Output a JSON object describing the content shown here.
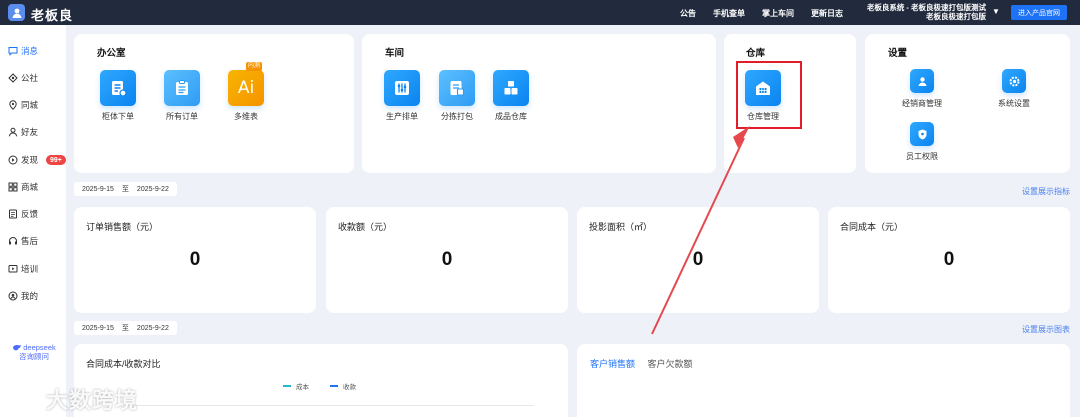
{
  "app": {
    "brand": "老板良"
  },
  "topnav": {
    "announce": "公告",
    "mobile": "手机查单",
    "workshop": "掌上车间",
    "changelog": "更新日志",
    "system_line1": "老板良系统 - 老板良极速打包版测试",
    "system_line2": "老板良极速打包版",
    "enter_site": "进入产品官网"
  },
  "sidebar": {
    "items": [
      {
        "label": "消息",
        "icon": "message-icon",
        "active": true
      },
      {
        "label": "公社",
        "icon": "community-icon"
      },
      {
        "label": "同城",
        "icon": "location-icon"
      },
      {
        "label": "好友",
        "icon": "friends-icon"
      },
      {
        "label": "发现",
        "icon": "discover-icon",
        "badge": "99+"
      },
      {
        "label": "商城",
        "icon": "mall-icon"
      },
      {
        "label": "反馈",
        "icon": "feedback-icon"
      },
      {
        "label": "售后",
        "icon": "after-sales-icon"
      },
      {
        "label": "培训",
        "icon": "training-icon"
      },
      {
        "label": "我的",
        "icon": "profile-icon"
      }
    ],
    "deepseek": {
      "name": "deepseek",
      "caption": "咨询顾问"
    }
  },
  "office": {
    "title": "办公室",
    "apps": [
      {
        "label": "柜体下单",
        "icon": "cabinet-order-icon"
      },
      {
        "label": "所有订单",
        "icon": "all-orders-icon"
      },
      {
        "label": "多维表",
        "icon": "ai-table-icon",
        "glyph": "Ai",
        "tag": "内测"
      }
    ]
  },
  "workshop": {
    "title": "车间",
    "apps": [
      {
        "label": "生产排单",
        "icon": "production-schedule-icon"
      },
      {
        "label": "分拣打包",
        "icon": "sorting-packing-icon"
      },
      {
        "label": "成品仓库",
        "icon": "finished-goods-icon"
      }
    ]
  },
  "warehouse": {
    "title": "仓库",
    "apps": [
      {
        "label": "仓库管理",
        "icon": "warehouse-icon"
      }
    ]
  },
  "settings": {
    "title": "设置",
    "apps": [
      {
        "label": "经销商管理",
        "icon": "dealer-icon"
      },
      {
        "label": "系统设置",
        "icon": "system-settings-icon"
      },
      {
        "label": "员工权限",
        "icon": "staff-permission-icon"
      }
    ]
  },
  "range1": {
    "start": "2025-9-15",
    "sep": "至",
    "end": "2025-9-22",
    "link": "设置展示指标"
  },
  "stats": [
    {
      "label": "订单销售额（元）",
      "value": "0"
    },
    {
      "label": "收款额（元）",
      "value": "0"
    },
    {
      "label": "投影面积（㎡）",
      "value": "0"
    },
    {
      "label": "合同成本（元）",
      "value": "0"
    }
  ],
  "range2": {
    "start": "2025-9-15",
    "sep": "至",
    "end": "2025-9-22",
    "link": "设置展示图表"
  },
  "compare_chart": {
    "title": "合同成本/收款对比",
    "legend": [
      {
        "name": "成本",
        "color": "#22b8cf"
      },
      {
        "name": "收款",
        "color": "#1d72f5"
      }
    ]
  },
  "sales_tabs": [
    {
      "label": "客户销售额",
      "active": true
    },
    {
      "label": "客户欠款额"
    }
  ],
  "watermark": "大数跨境"
}
